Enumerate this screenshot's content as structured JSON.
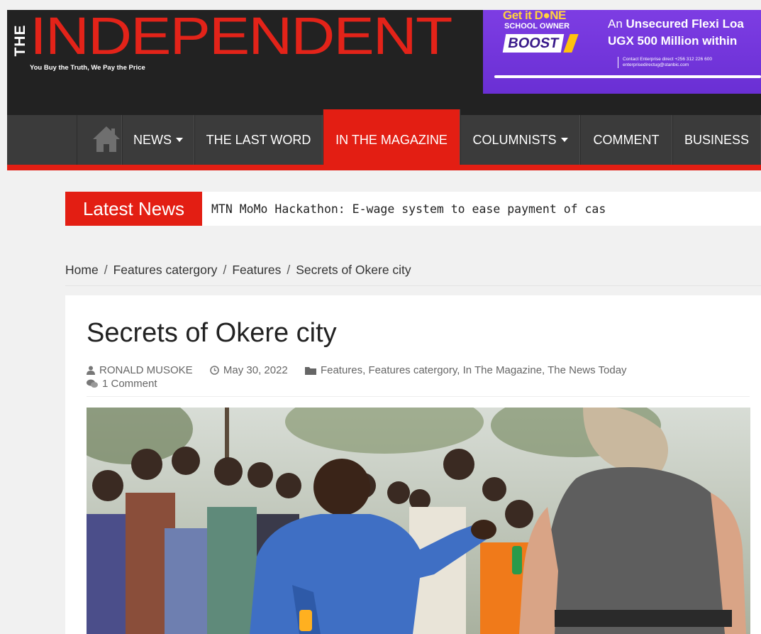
{
  "header": {
    "logo_prefix": "THE",
    "logo_name": "INDEPENDENT",
    "tagline": "You Buy the Truth, We Pay the Price"
  },
  "ad": {
    "get_it_done": "Get it D●NE",
    "school_owner": "SCHOOL OWNER",
    "boost": "BOOST",
    "headline_line1_a": "An ",
    "headline_line1_b": "Unsecured Flexi Loa",
    "headline_line2": "UGX 500 Million within",
    "contact_line1": "Contact Enterprise direct +256 312 226 600",
    "contact_line2": "enterprisedirectug@stanbic.com",
    "accent_color": "#6e34d8"
  },
  "nav": {
    "items": [
      {
        "label": "NEWS",
        "dropdown": true
      },
      {
        "label": "THE LAST WORD",
        "dropdown": false
      },
      {
        "label": "IN THE MAGAZINE",
        "dropdown": false,
        "active": true
      },
      {
        "label": "COLUMNISTS",
        "dropdown": true
      },
      {
        "label": "COMMENT",
        "dropdown": false
      },
      {
        "label": "BUSINESS",
        "dropdown": false
      }
    ],
    "active_color": "#e31e13"
  },
  "ticker": {
    "label": "Latest News",
    "headline": "MTN MoMo Hackathon: E-wage system to ease payment of cas"
  },
  "breadcrumb": {
    "items": [
      "Home",
      "Features catergory",
      "Features",
      "Secrets of Okere city"
    ],
    "separator": "/"
  },
  "article": {
    "title": "Secrets of Okere city",
    "author": "RONALD MUSOKE",
    "date": "May 30, 2022",
    "categories": "Features, Features catergory, In The Magazine, The News Today",
    "comments": "1 Comment"
  }
}
